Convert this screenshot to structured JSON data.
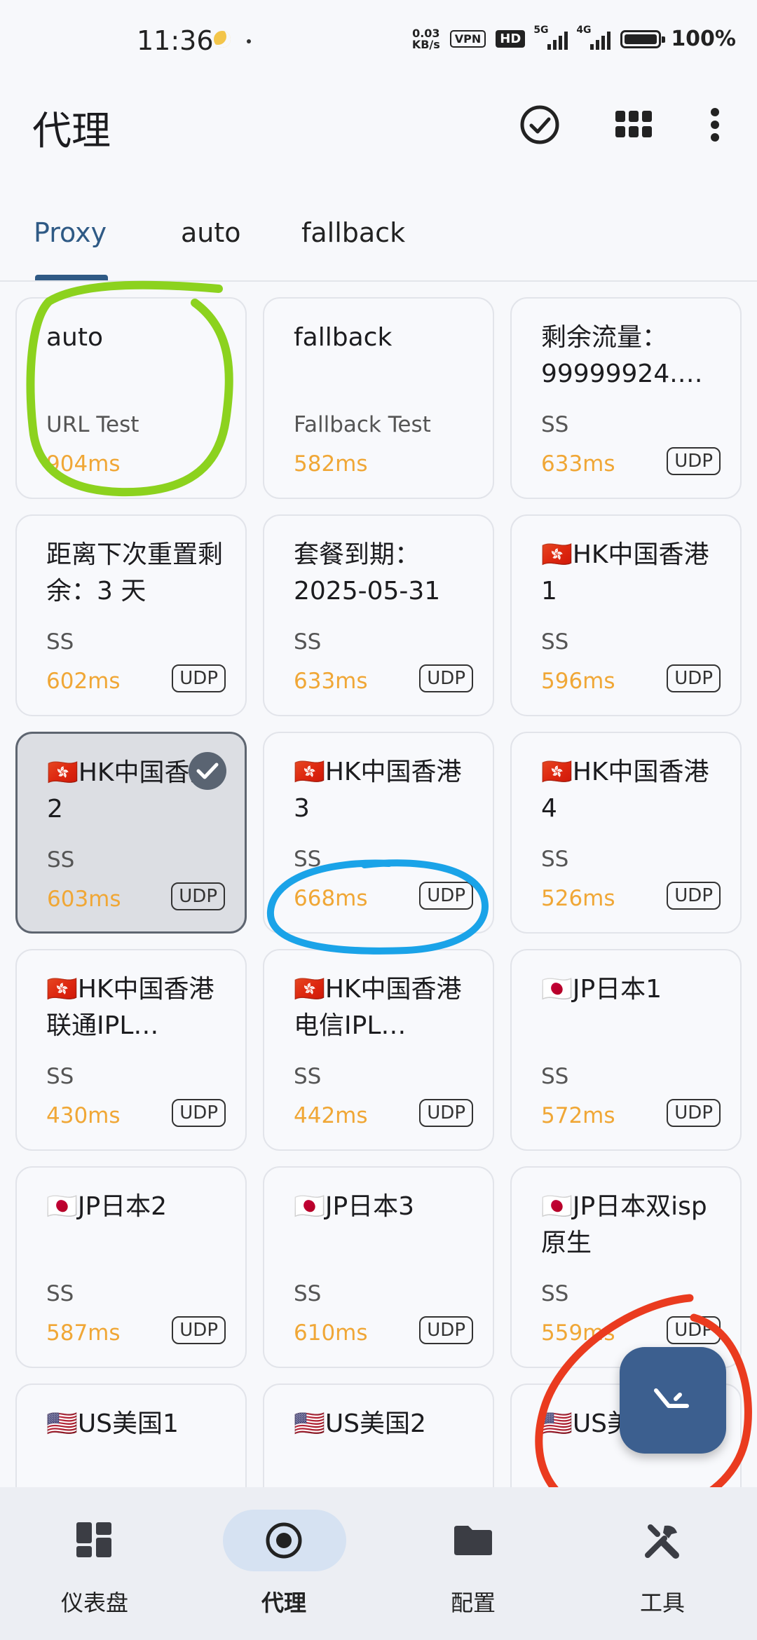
{
  "status_bar": {
    "time": "11:36",
    "net_speed_value": "0.03",
    "net_speed_unit": "KB/s",
    "vpn": "VPN",
    "hd": "HD",
    "sig1_tag": "5G",
    "sig2_tag": "4G",
    "battery": "100%"
  },
  "app_bar": {
    "title": "代理",
    "icons": [
      "check-circle-icon",
      "grid-view-icon",
      "more-vert-icon"
    ]
  },
  "tabs": [
    "Proxy",
    "auto",
    "fallback"
  ],
  "active_tab": 0,
  "proxies": [
    {
      "name": "auto",
      "type": "URL Test",
      "delay": "904ms",
      "udp": ""
    },
    {
      "name": "fallback",
      "type": "Fallback Test",
      "delay": "582ms",
      "udp": ""
    },
    {
      "name": "剩余流量：99999924.…",
      "type": "SS",
      "delay": "633ms",
      "udp": "UDP"
    },
    {
      "name": "距离下次重置剩余：3 天",
      "type": "SS",
      "delay": "602ms",
      "udp": "UDP"
    },
    {
      "name": "套餐到期：2025-05-31",
      "type": "SS",
      "delay": "633ms",
      "udp": "UDP"
    },
    {
      "name": "🇭🇰HK中国香港1",
      "type": "SS",
      "delay": "596ms",
      "udp": "UDP"
    },
    {
      "name": "🇭🇰HK中国香港2",
      "type": "SS",
      "delay": "603ms",
      "udp": "UDP",
      "selected": true
    },
    {
      "name": "🇭🇰HK中国香港3",
      "type": "SS",
      "delay": "668ms",
      "udp": "UDP"
    },
    {
      "name": "🇭🇰HK中国香港4",
      "type": "SS",
      "delay": "526ms",
      "udp": "UDP"
    },
    {
      "name": "🇭🇰HK中国香港 联通IPL…",
      "type": "SS",
      "delay": "430ms",
      "udp": "UDP"
    },
    {
      "name": "🇭🇰HK中国香港 电信IPL…",
      "type": "SS",
      "delay": "442ms",
      "udp": "UDP"
    },
    {
      "name": "🇯🇵JP日本1",
      "type": "SS",
      "delay": "572ms",
      "udp": "UDP"
    },
    {
      "name": "🇯🇵JP日本2",
      "type": "SS",
      "delay": "587ms",
      "udp": "UDP"
    },
    {
      "name": "🇯🇵JP日本3",
      "type": "SS",
      "delay": "610ms",
      "udp": "UDP"
    },
    {
      "name": "🇯🇵JP日本双isp原生",
      "type": "SS",
      "delay": "559ms",
      "udp": "UDP"
    },
    {
      "name": "🇺🇸US美国1",
      "type": "",
      "delay": "",
      "udp": ""
    },
    {
      "name": "🇺🇸US美国2",
      "type": "",
      "delay": "",
      "udp": ""
    },
    {
      "name": "🇺🇸US美",
      "type": "",
      "delay": "",
      "udp": ""
    }
  ],
  "fab": {
    "icon": "network-speed-test-icon"
  },
  "bottom_nav": [
    {
      "label": "仪表盘",
      "icon": "dashboard-icon"
    },
    {
      "label": "代理",
      "icon": "radio-target-icon"
    },
    {
      "label": "配置",
      "icon": "folder-icon"
    },
    {
      "label": "工具",
      "icon": "tools-icon"
    }
  ],
  "active_nav": 1,
  "annotation_colors": {
    "green": "#8cd21e",
    "blue": "#1aa3e8",
    "red": "#ea3b1f"
  }
}
